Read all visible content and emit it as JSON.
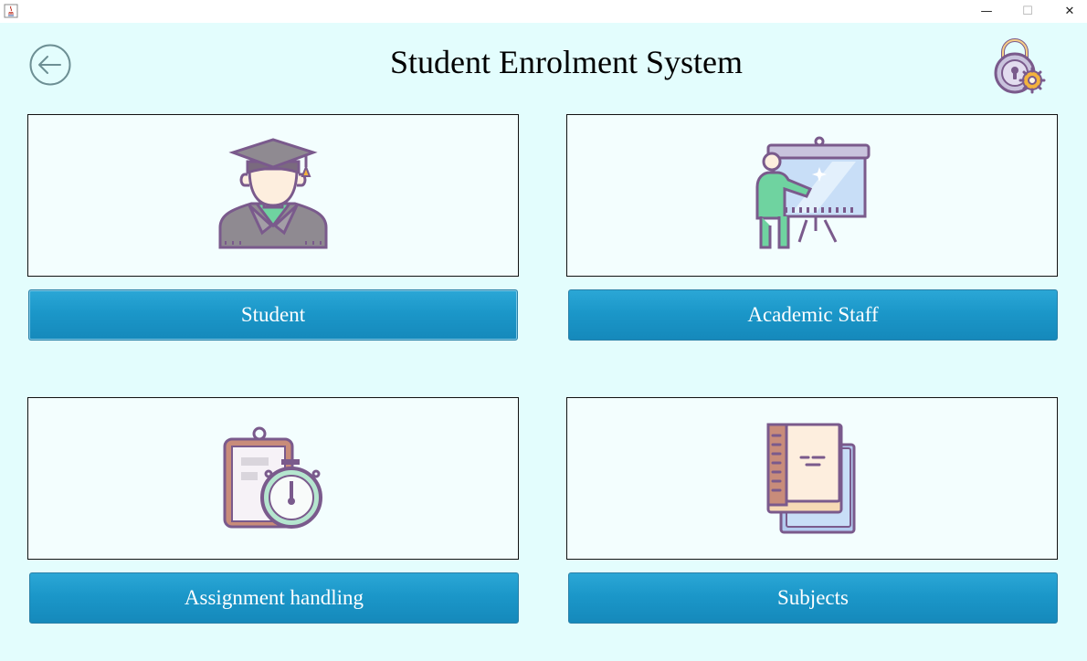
{
  "window": {
    "minimize_glyph": "—",
    "maximize_glyph": "☐",
    "close_glyph": "✕"
  },
  "header": {
    "title": "Student Enrolment System"
  },
  "menu": {
    "student_label": "Student",
    "staff_label": "Academic Staff",
    "assignment_label": "Assignment handling",
    "subjects_label": "Subjects"
  },
  "colors": {
    "background": "#e3fdfd",
    "button": "#1b97c9",
    "icon_outline": "#7a5a8c"
  }
}
